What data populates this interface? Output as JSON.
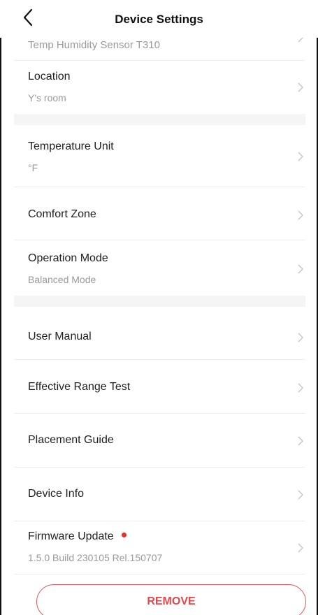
{
  "header": {
    "title": "Device Settings",
    "back_icon": "chevron-left-icon"
  },
  "sections": {
    "device_name": "Temp Humidity Sensor T310",
    "location": {
      "label": "Location",
      "value": "Y's room"
    },
    "temperature_unit": {
      "label": "Temperature Unit",
      "value": "°F"
    },
    "comfort_zone": {
      "label": "Comfort Zone"
    },
    "operation_mode": {
      "label": "Operation Mode",
      "value": "Balanced Mode"
    },
    "user_manual": {
      "label": "User Manual"
    },
    "effective_range_test": {
      "label": "Effective Range Test"
    },
    "placement_guide": {
      "label": "Placement Guide"
    },
    "device_info": {
      "label": "Device Info"
    },
    "firmware_update": {
      "label": "Firmware Update",
      "value": "1.5.0 Build 230105 Rel.150707"
    }
  },
  "remove_button": {
    "label": "REMOVE"
  },
  "colors": {
    "accent_red": "#e2474c",
    "update_dot": "#e5302b",
    "secondary_text": "#9a9a9a",
    "section_gap": "#f5f5f5"
  }
}
